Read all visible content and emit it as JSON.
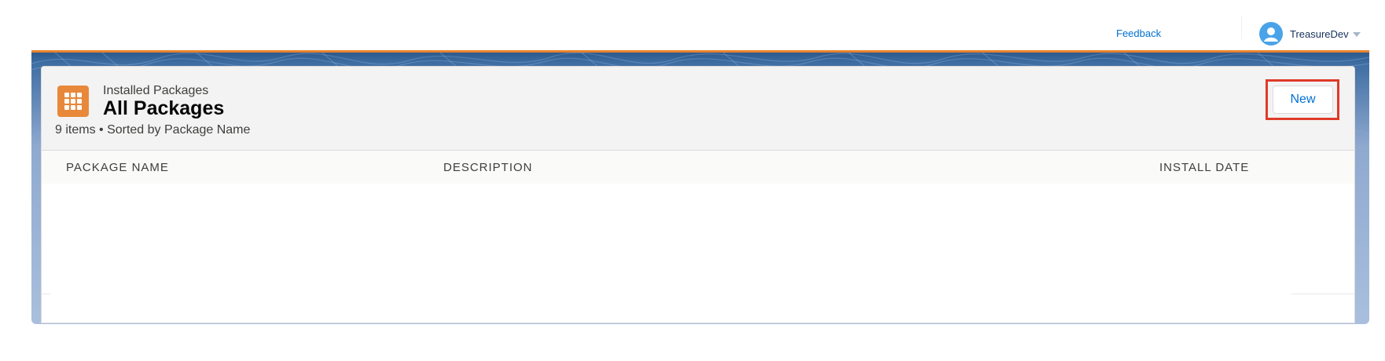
{
  "header": {
    "feedback_label": "Feedback",
    "user_name": "TreasureDev"
  },
  "list": {
    "object_label": "Installed Packages",
    "view_name": "All Packages",
    "summary": "9 items • Sorted by Package Name",
    "new_button_label": "New",
    "columns": [
      "PACKAGE NAME",
      "DESCRIPTION",
      "INSTALL DATE"
    ]
  },
  "colors": {
    "brand_orange": "#e8883a",
    "link_blue": "#0070d2",
    "highlight_red": "#e03a2a"
  }
}
